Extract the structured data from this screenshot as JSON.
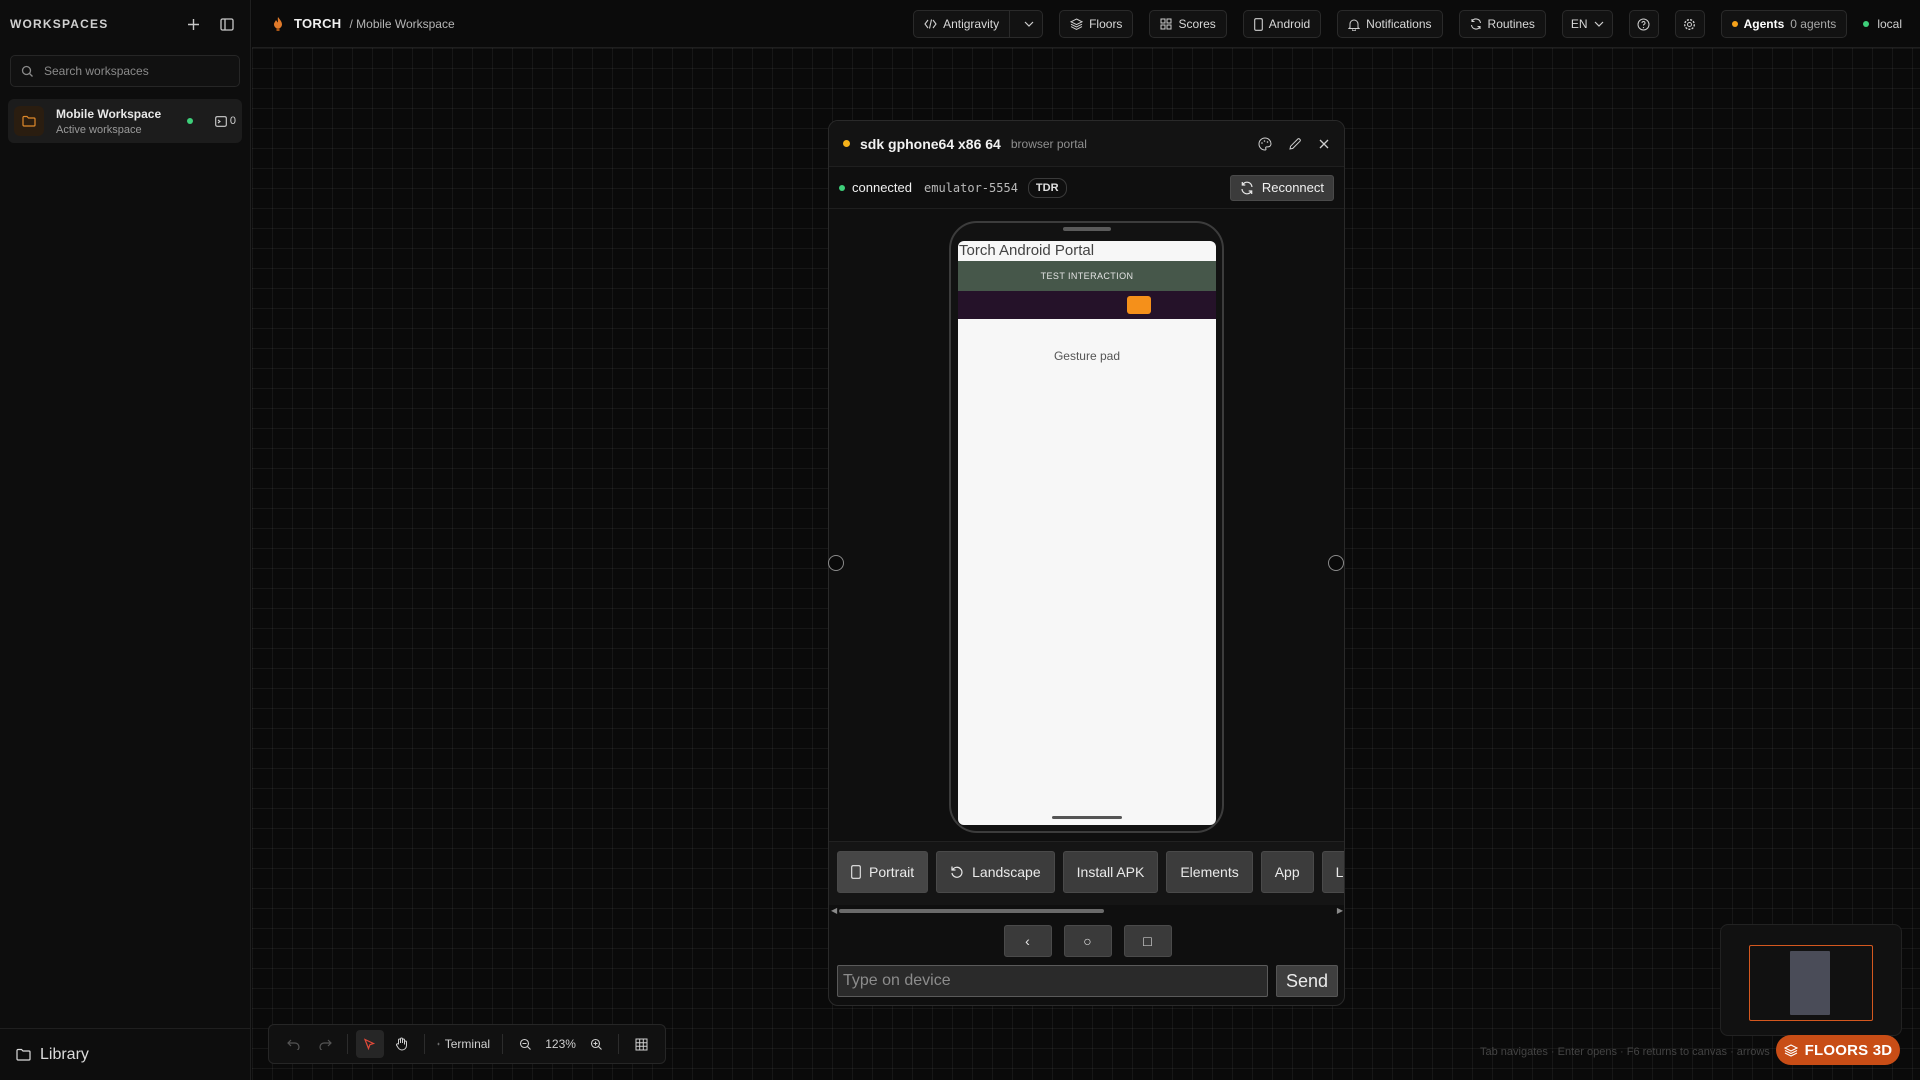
{
  "sidebar": {
    "title": "WORKSPACES",
    "search_placeholder": "Search workspaces",
    "workspace": {
      "name": "Mobile Workspace",
      "subtitle": "Active workspace",
      "count": "0"
    },
    "footer_label": "Library"
  },
  "topbar": {
    "brand": "TORCH",
    "breadcrumb": "/ Mobile Workspace",
    "buttons": {
      "antigravity": "Antigravity",
      "floors": "Floors",
      "scores": "Scores",
      "android": "Android",
      "notifications": "Notifications",
      "routines": "Routines",
      "language": "EN"
    },
    "agents": {
      "label": "Agents",
      "count_text": "0 agents"
    },
    "local_label": "local"
  },
  "device_window": {
    "title": "sdk gphone64 x86 64",
    "tag": "browser portal",
    "status": "connected",
    "serial": "emulator-5554",
    "badge": "TDR",
    "reconnect_label": "Reconnect",
    "screen": {
      "app_title": "Torch Android Portal",
      "button_label": "TEST INTERACTION",
      "gesture_label": "Gesture pad"
    },
    "modes": [
      "Portrait",
      "Landscape",
      "Install APK",
      "Elements",
      "App",
      "Logs"
    ],
    "nav": {
      "back": "‹",
      "home": "○",
      "recents": "□"
    },
    "type_placeholder": "Type on device",
    "send_label": "Send"
  },
  "toolbar": {
    "terminal_label": "Terminal",
    "zoom": "123%"
  },
  "hints": "Tab navigates · Enter opens · F6 returns to canvas · arrows",
  "floors3d_label": "FLOORS 3D",
  "colors": {
    "accent": "#c84d16",
    "connected": "#3ecf7a",
    "warning": "#f5b21a"
  }
}
